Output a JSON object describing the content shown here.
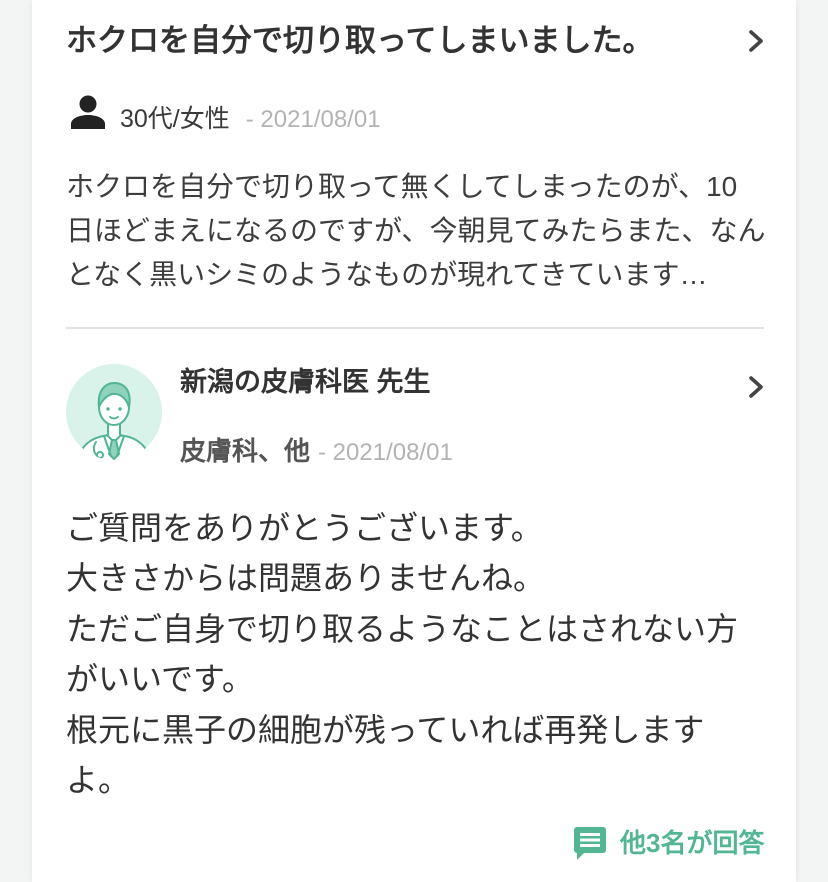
{
  "colors": {
    "accent": "#52b693",
    "text": "#333333",
    "muted": "#b3b3b3",
    "divider": "#e2e2e2",
    "avatar_bg": "#d9f2ea"
  },
  "icons": {
    "author": "person-icon",
    "open": "chevron-right-icon",
    "doctor": "doctor-avatar-icon",
    "answers": "comment-icon"
  },
  "question": {
    "title": "ホクロを自分で切り取ってしまいました。",
    "author": "30代/女性",
    "date": "- 2021/08/01",
    "body_lines": [
      "ホクロを自分で切り取って無くしてしまったのが、10",
      "日ほどまえになるのですが、今朝見てみたらまた、なん",
      "となく黒いシミのようなものが現れてきています…"
    ]
  },
  "answer": {
    "doctor_name": "新潟の皮膚科医 先生",
    "specialty": "皮膚科、他",
    "date": "- 2021/08/01",
    "body_lines": [
      "ご質問をありがとうございます。",
      "大きさからは問題ありませんね。",
      "ただご自身で切り取るようなことはされない方",
      "がいいです。",
      "根元に黒子の細胞が残っていれば再発します",
      "よ。"
    ]
  },
  "footer": {
    "other_answers": "他3名が回答"
  }
}
